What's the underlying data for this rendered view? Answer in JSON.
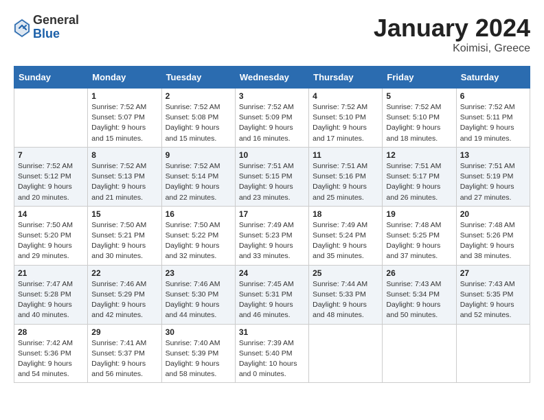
{
  "header": {
    "logo": {
      "general": "General",
      "blue": "Blue"
    },
    "month": "January 2024",
    "location": "Koimisi, Greece"
  },
  "days_of_week": [
    "Sunday",
    "Monday",
    "Tuesday",
    "Wednesday",
    "Thursday",
    "Friday",
    "Saturday"
  ],
  "weeks": [
    [
      {
        "day": "",
        "info": ""
      },
      {
        "day": "1",
        "info": "Sunrise: 7:52 AM\nSunset: 5:07 PM\nDaylight: 9 hours\nand 15 minutes."
      },
      {
        "day": "2",
        "info": "Sunrise: 7:52 AM\nSunset: 5:08 PM\nDaylight: 9 hours\nand 15 minutes."
      },
      {
        "day": "3",
        "info": "Sunrise: 7:52 AM\nSunset: 5:09 PM\nDaylight: 9 hours\nand 16 minutes."
      },
      {
        "day": "4",
        "info": "Sunrise: 7:52 AM\nSunset: 5:10 PM\nDaylight: 9 hours\nand 17 minutes."
      },
      {
        "day": "5",
        "info": "Sunrise: 7:52 AM\nSunset: 5:10 PM\nDaylight: 9 hours\nand 18 minutes."
      },
      {
        "day": "6",
        "info": "Sunrise: 7:52 AM\nSunset: 5:11 PM\nDaylight: 9 hours\nand 19 minutes."
      }
    ],
    [
      {
        "day": "7",
        "info": "Sunrise: 7:52 AM\nSunset: 5:12 PM\nDaylight: 9 hours\nand 20 minutes."
      },
      {
        "day": "8",
        "info": "Sunrise: 7:52 AM\nSunset: 5:13 PM\nDaylight: 9 hours\nand 21 minutes."
      },
      {
        "day": "9",
        "info": "Sunrise: 7:52 AM\nSunset: 5:14 PM\nDaylight: 9 hours\nand 22 minutes."
      },
      {
        "day": "10",
        "info": "Sunrise: 7:51 AM\nSunset: 5:15 PM\nDaylight: 9 hours\nand 23 minutes."
      },
      {
        "day": "11",
        "info": "Sunrise: 7:51 AM\nSunset: 5:16 PM\nDaylight: 9 hours\nand 25 minutes."
      },
      {
        "day": "12",
        "info": "Sunrise: 7:51 AM\nSunset: 5:17 PM\nDaylight: 9 hours\nand 26 minutes."
      },
      {
        "day": "13",
        "info": "Sunrise: 7:51 AM\nSunset: 5:19 PM\nDaylight: 9 hours\nand 27 minutes."
      }
    ],
    [
      {
        "day": "14",
        "info": "Sunrise: 7:50 AM\nSunset: 5:20 PM\nDaylight: 9 hours\nand 29 minutes."
      },
      {
        "day": "15",
        "info": "Sunrise: 7:50 AM\nSunset: 5:21 PM\nDaylight: 9 hours\nand 30 minutes."
      },
      {
        "day": "16",
        "info": "Sunrise: 7:50 AM\nSunset: 5:22 PM\nDaylight: 9 hours\nand 32 minutes."
      },
      {
        "day": "17",
        "info": "Sunrise: 7:49 AM\nSunset: 5:23 PM\nDaylight: 9 hours\nand 33 minutes."
      },
      {
        "day": "18",
        "info": "Sunrise: 7:49 AM\nSunset: 5:24 PM\nDaylight: 9 hours\nand 35 minutes."
      },
      {
        "day": "19",
        "info": "Sunrise: 7:48 AM\nSunset: 5:25 PM\nDaylight: 9 hours\nand 37 minutes."
      },
      {
        "day": "20",
        "info": "Sunrise: 7:48 AM\nSunset: 5:26 PM\nDaylight: 9 hours\nand 38 minutes."
      }
    ],
    [
      {
        "day": "21",
        "info": "Sunrise: 7:47 AM\nSunset: 5:28 PM\nDaylight: 9 hours\nand 40 minutes."
      },
      {
        "day": "22",
        "info": "Sunrise: 7:46 AM\nSunset: 5:29 PM\nDaylight: 9 hours\nand 42 minutes."
      },
      {
        "day": "23",
        "info": "Sunrise: 7:46 AM\nSunset: 5:30 PM\nDaylight: 9 hours\nand 44 minutes."
      },
      {
        "day": "24",
        "info": "Sunrise: 7:45 AM\nSunset: 5:31 PM\nDaylight: 9 hours\nand 46 minutes."
      },
      {
        "day": "25",
        "info": "Sunrise: 7:44 AM\nSunset: 5:33 PM\nDaylight: 9 hours\nand 48 minutes."
      },
      {
        "day": "26",
        "info": "Sunrise: 7:43 AM\nSunset: 5:34 PM\nDaylight: 9 hours\nand 50 minutes."
      },
      {
        "day": "27",
        "info": "Sunrise: 7:43 AM\nSunset: 5:35 PM\nDaylight: 9 hours\nand 52 minutes."
      }
    ],
    [
      {
        "day": "28",
        "info": "Sunrise: 7:42 AM\nSunset: 5:36 PM\nDaylight: 9 hours\nand 54 minutes."
      },
      {
        "day": "29",
        "info": "Sunrise: 7:41 AM\nSunset: 5:37 PM\nDaylight: 9 hours\nand 56 minutes."
      },
      {
        "day": "30",
        "info": "Sunrise: 7:40 AM\nSunset: 5:39 PM\nDaylight: 9 hours\nand 58 minutes."
      },
      {
        "day": "31",
        "info": "Sunrise: 7:39 AM\nSunset: 5:40 PM\nDaylight: 10 hours\nand 0 minutes."
      },
      {
        "day": "",
        "info": ""
      },
      {
        "day": "",
        "info": ""
      },
      {
        "day": "",
        "info": ""
      }
    ]
  ]
}
